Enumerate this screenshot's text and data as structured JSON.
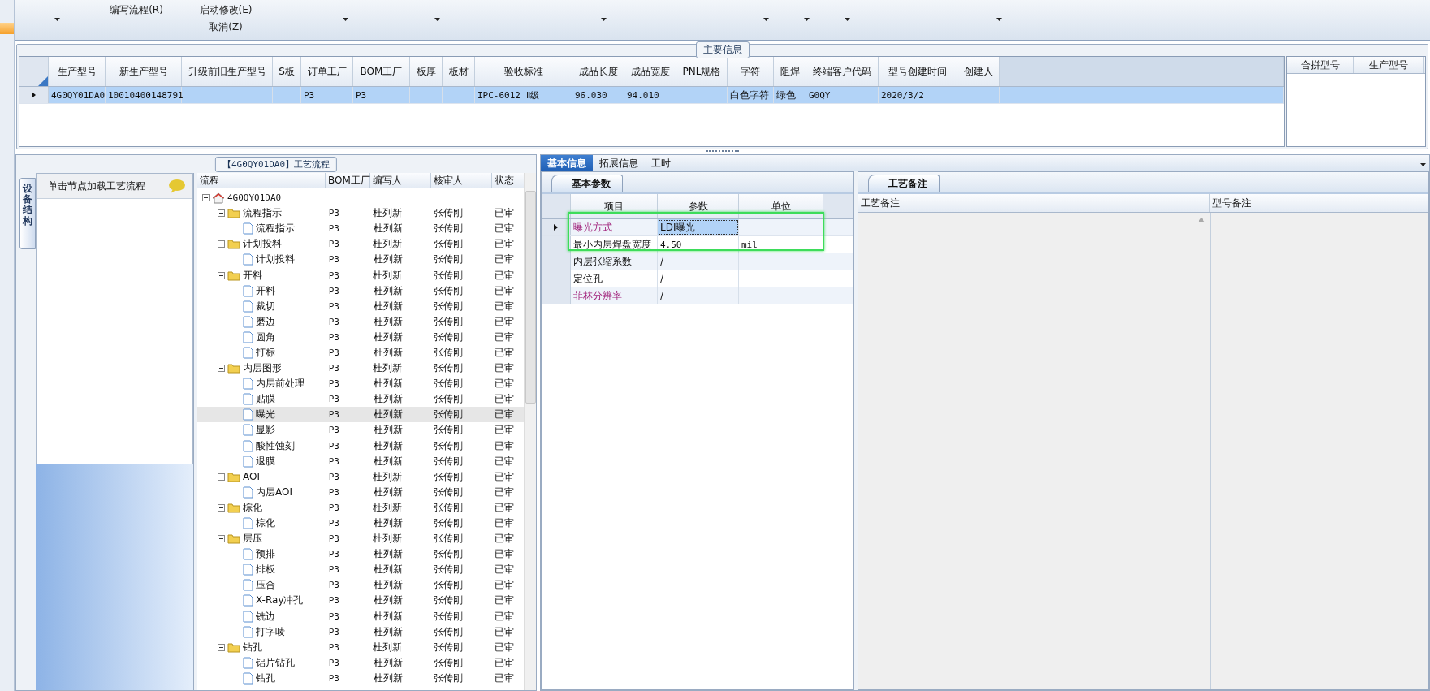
{
  "toolbar": {
    "items": [
      {
        "kind": "caret"
      },
      {
        "kind": "button",
        "label": "编写流程(R)"
      },
      {
        "kind": "stack",
        "labels": [
          "启动修改(E)",
          "取消(Z)"
        ]
      },
      {
        "kind": "caret"
      },
      {
        "kind": "caret"
      },
      {
        "kind": "caret"
      },
      {
        "kind": "caret"
      },
      {
        "kind": "caret"
      },
      {
        "kind": "caret"
      },
      {
        "kind": "caret"
      }
    ]
  },
  "main_info": {
    "title": "主要信息",
    "columns": [
      "生产型号",
      "新生产型号",
      "升级前旧生产型号",
      "S板",
      "订单工厂",
      "BOM工厂",
      "板厚",
      "板材",
      "验收标准",
      "成品长度",
      "成品宽度",
      "PNL规格",
      "字符",
      "阻焊",
      "终端客户代码",
      "型号创建时间",
      "创建人"
    ],
    "rows": [
      {
        "selected": true,
        "cells": [
          "4G0QY01DA0",
          "10010400148791",
          null,
          null,
          "P3",
          "P3",
          null,
          null,
          "IPC-6012 Ⅱ级",
          "96.030",
          "94.010",
          null,
          "白色字符",
          "绿色",
          "G0QY",
          "2020/3/2",
          null
        ]
      }
    ],
    "side_columns": [
      "合拼型号",
      "生产型号"
    ]
  },
  "process": {
    "title": "【4G0QY01DA0】工艺流程",
    "side_tab": "设备结构",
    "hint": "单击节点加载工艺流程",
    "columns": [
      "流程",
      "BOM工厂",
      "编写人",
      "核审人",
      "状态"
    ],
    "tree": [
      {
        "name": "4G0QY01DA0",
        "kind": "root",
        "expanded": true,
        "selected": false,
        "children": [
          {
            "name": "流程指示",
            "kind": "folder",
            "expanded": true,
            "selected": false,
            "bom": "P3",
            "writer": "杜列新",
            "reviewer": "张传刚",
            "status": "已审",
            "children": [
              {
                "name": "流程指示",
                "kind": "leaf",
                "selected": false,
                "bom": "P3",
                "writer": "杜列新",
                "reviewer": "张传刚",
                "status": "已审"
              }
            ]
          },
          {
            "name": "计划投料",
            "kind": "folder",
            "expanded": true,
            "selected": false,
            "bom": "P3",
            "writer": "杜列新",
            "reviewer": "张传刚",
            "status": "已审",
            "children": [
              {
                "name": "计划投料",
                "kind": "leaf",
                "selected": false,
                "bom": "P3",
                "writer": "杜列新",
                "reviewer": "张传刚",
                "status": "已审"
              }
            ]
          },
          {
            "name": "开料",
            "kind": "folder",
            "expanded": true,
            "selected": false,
            "bom": "P3",
            "writer": "杜列新",
            "reviewer": "张传刚",
            "status": "已审",
            "children": [
              {
                "name": "开料",
                "kind": "leaf",
                "selected": false,
                "bom": "P3",
                "writer": "杜列新",
                "reviewer": "张传刚",
                "status": "已审"
              },
              {
                "name": "裁切",
                "kind": "leaf",
                "selected": false,
                "bom": "P3",
                "writer": "杜列新",
                "reviewer": "张传刚",
                "status": "已审"
              },
              {
                "name": "磨边",
                "kind": "leaf",
                "selected": false,
                "bom": "P3",
                "writer": "杜列新",
                "reviewer": "张传刚",
                "status": "已审"
              },
              {
                "name": "圆角",
                "kind": "leaf",
                "selected": false,
                "bom": "P3",
                "writer": "杜列新",
                "reviewer": "张传刚",
                "status": "已审"
              },
              {
                "name": "打标",
                "kind": "leaf",
                "selected": false,
                "bom": "P3",
                "writer": "杜列新",
                "reviewer": "张传刚",
                "status": "已审"
              }
            ]
          },
          {
            "name": "内层图形",
            "kind": "folder",
            "expanded": true,
            "selected": false,
            "bom": "P3",
            "writer": "杜列新",
            "reviewer": "张传刚",
            "status": "已审",
            "children": [
              {
                "name": "内层前处理",
                "kind": "leaf",
                "selected": false,
                "bom": "P3",
                "writer": "杜列新",
                "reviewer": "张传刚",
                "status": "已审"
              },
              {
                "name": "贴膜",
                "kind": "leaf",
                "selected": false,
                "bom": "P3",
                "writer": "杜列新",
                "reviewer": "张传刚",
                "status": "已审"
              },
              {
                "name": "曝光",
                "kind": "leaf",
                "selected": true,
                "bom": "P3",
                "writer": "杜列新",
                "reviewer": "张传刚",
                "status": "已审"
              },
              {
                "name": "显影",
                "kind": "leaf",
                "selected": false,
                "bom": "P3",
                "writer": "杜列新",
                "reviewer": "张传刚",
                "status": "已审"
              },
              {
                "name": "酸性蚀刻",
                "kind": "leaf",
                "selected": false,
                "bom": "P3",
                "writer": "杜列新",
                "reviewer": "张传刚",
                "status": "已审"
              },
              {
                "name": "退膜",
                "kind": "leaf",
                "selected": false,
                "bom": "P3",
                "writer": "杜列新",
                "reviewer": "张传刚",
                "status": "已审"
              }
            ]
          },
          {
            "name": "AOI",
            "kind": "folder",
            "expanded": true,
            "selected": false,
            "bom": "P3",
            "writer": "杜列新",
            "reviewer": "张传刚",
            "status": "已审",
            "children": [
              {
                "name": "内层AOI",
                "kind": "leaf",
                "selected": false,
                "bom": "P3",
                "writer": "杜列新",
                "reviewer": "张传刚",
                "status": "已审"
              }
            ]
          },
          {
            "name": "棕化",
            "kind": "folder",
            "expanded": true,
            "selected": false,
            "bom": "P3",
            "writer": "杜列新",
            "reviewer": "张传刚",
            "status": "已审",
            "children": [
              {
                "name": "棕化",
                "kind": "leaf",
                "selected": false,
                "bom": "P3",
                "writer": "杜列新",
                "reviewer": "张传刚",
                "status": "已审"
              }
            ]
          },
          {
            "name": "层压",
            "kind": "folder",
            "expanded": true,
            "selected": false,
            "bom": "P3",
            "writer": "杜列新",
            "reviewer": "张传刚",
            "status": "已审",
            "children": [
              {
                "name": "预排",
                "kind": "leaf",
                "selected": false,
                "bom": "P3",
                "writer": "杜列新",
                "reviewer": "张传刚",
                "status": "已审"
              },
              {
                "name": "排板",
                "kind": "leaf",
                "selected": false,
                "bom": "P3",
                "writer": "杜列新",
                "reviewer": "张传刚",
                "status": "已审"
              },
              {
                "name": "压合",
                "kind": "leaf",
                "selected": false,
                "bom": "P3",
                "writer": "杜列新",
                "reviewer": "张传刚",
                "status": "已审"
              },
              {
                "name": "X-Ray冲孔",
                "kind": "leaf",
                "selected": false,
                "bom": "P3",
                "writer": "杜列新",
                "reviewer": "张传刚",
                "status": "已审"
              },
              {
                "name": "铣边",
                "kind": "leaf",
                "selected": false,
                "bom": "P3",
                "writer": "杜列新",
                "reviewer": "张传刚",
                "status": "已审"
              },
              {
                "name": "打字唛",
                "kind": "leaf",
                "selected": false,
                "bom": "P3",
                "writer": "杜列新",
                "reviewer": "张传刚",
                "status": "已审"
              }
            ]
          },
          {
            "name": "钻孔",
            "kind": "folder",
            "expanded": true,
            "selected": false,
            "bom": "P3",
            "writer": "杜列新",
            "reviewer": "张传刚",
            "status": "已审",
            "children": [
              {
                "name": "铝片钻孔",
                "kind": "leaf",
                "selected": false,
                "bom": "P3",
                "writer": "杜列新",
                "reviewer": "张传刚",
                "status": "已审"
              },
              {
                "name": "钻孔",
                "kind": "leaf",
                "selected": false,
                "bom": "P3",
                "writer": "杜列新",
                "reviewer": "张传刚",
                "status": "已审"
              }
            ]
          }
        ]
      }
    ]
  },
  "detail": {
    "tabs": [
      {
        "label": "基本信息",
        "selected": true
      },
      {
        "label": "拓展信息",
        "selected": false
      },
      {
        "label": "工时",
        "selected": false
      }
    ],
    "params": {
      "tab": "基本参数",
      "columns": [
        "项目",
        "参数",
        "单位"
      ],
      "rows": [
        {
          "item": "曝光方式",
          "value": "LDI曝光",
          "emphasized": true,
          "selected": true
        },
        {
          "item": "最小内层焊盘宽度",
          "value": "4.50",
          "unit": "mil",
          "emphasized": false,
          "selected": false
        },
        {
          "item": "内层张缩系数",
          "value": "/",
          "emphasized": false,
          "selected": false
        },
        {
          "item": "定位孔",
          "value": "/",
          "emphasized": false,
          "selected": false
        },
        {
          "item": "菲林分辨率",
          "value": "/",
          "emphasized": true,
          "selected": false
        }
      ]
    },
    "remarks": {
      "tab": "工艺备注",
      "columns": [
        "工艺备注",
        "型号备注"
      ]
    }
  }
}
